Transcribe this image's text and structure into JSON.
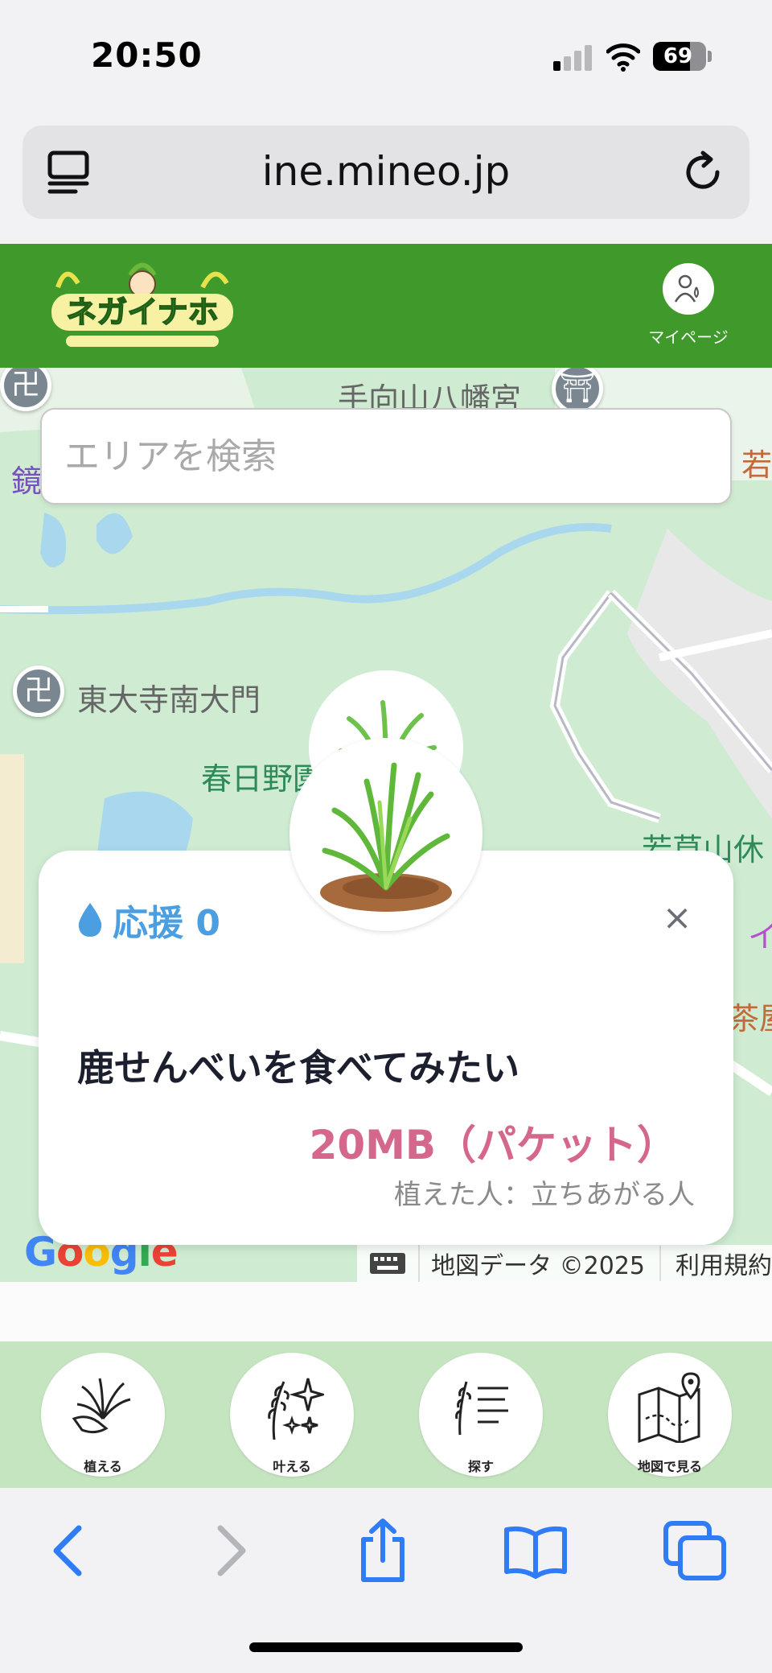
{
  "status_bar": {
    "time": "20:50",
    "battery": "69",
    "battery_level": 0.69
  },
  "browser": {
    "url": "ine.mineo.jp"
  },
  "app_header": {
    "mypage_label": "マイページ"
  },
  "map": {
    "search_placeholder": "エリアを検索",
    "labels": {
      "top_shrine": "手向山八幡宮",
      "todaiji": "東大寺南大門",
      "kasugano": "春日野園",
      "wakakusa": "若草山休",
      "edge_right_top": "若",
      "edge_left": "鏡",
      "edge_right_i": "イ",
      "edge_right_chaya": "茶屋"
    },
    "google": "Google",
    "map_data": "地図データ ©2025",
    "terms": "利用規約"
  },
  "card": {
    "support_label": "応援 0",
    "close": "×",
    "wish": "鹿せんべいを食べてみたい",
    "reward": "20MB（パケット）",
    "planter": "植えた人：立ちあがる人"
  },
  "nav": {
    "plant": "植える",
    "fulfill": "叶える",
    "search": "探す",
    "map": "地図で見る"
  },
  "colors": {
    "header_green": "#3f9a2b",
    "support_blue": "#4b9fe0",
    "reward_pink": "#d6678c",
    "nav_green": "#c5e4c0"
  }
}
